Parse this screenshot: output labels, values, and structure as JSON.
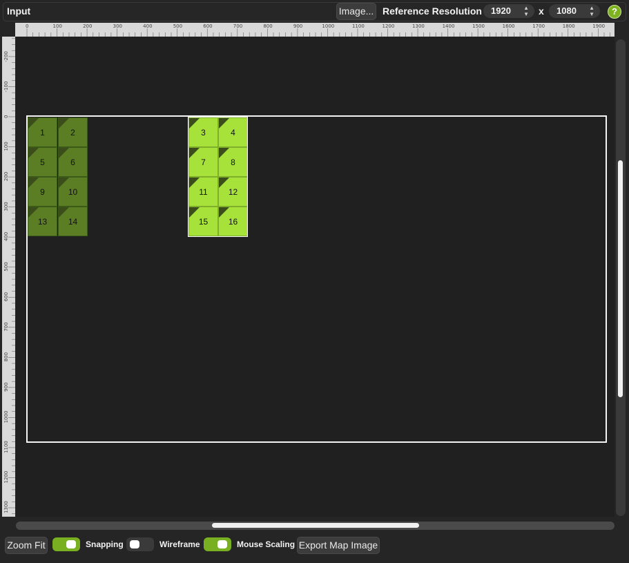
{
  "header": {
    "title": "Input",
    "image_button": "Image...",
    "ref_label": "Reference Resolution",
    "width": "1920",
    "x_label": "x",
    "height": "1080",
    "help": "?"
  },
  "ruler_h": [
    "0",
    "100",
    "200",
    "300",
    "400",
    "500",
    "600",
    "700",
    "800",
    "900",
    "1000",
    "1100",
    "1200",
    "1300",
    "1400",
    "1500",
    "1600",
    "1700",
    "1800",
    "1900"
  ],
  "ruler_v": [
    "-200",
    "-100",
    "0",
    "100",
    "200",
    "300",
    "400",
    "500",
    "600",
    "700",
    "800",
    "900",
    "1000",
    "1100",
    "1200",
    "1300"
  ],
  "tiles": [
    {
      "label": "1",
      "style": "dark"
    },
    {
      "label": "2",
      "style": "dark"
    },
    {
      "label": "3",
      "style": "light"
    },
    {
      "label": "4",
      "style": "light"
    },
    {
      "label": "5",
      "style": "dark"
    },
    {
      "label": "6",
      "style": "dark"
    },
    {
      "label": "7",
      "style": "light"
    },
    {
      "label": "8",
      "style": "light"
    },
    {
      "label": "9",
      "style": "dark"
    },
    {
      "label": "10",
      "style": "dark"
    },
    {
      "label": "11",
      "style": "light"
    },
    {
      "label": "12",
      "style": "light"
    },
    {
      "label": "13",
      "style": "dark"
    },
    {
      "label": "14",
      "style": "dark"
    },
    {
      "label": "15",
      "style": "light"
    },
    {
      "label": "16",
      "style": "light"
    }
  ],
  "footer": {
    "zoom_fit": "Zoom Fit",
    "snapping": {
      "label": "Snapping",
      "on": true
    },
    "wireframe": {
      "label": "Wireframe",
      "on": false
    },
    "mouse_scaling": {
      "label": "Mouse Scaling",
      "on": true
    },
    "export": "Export Map Image"
  },
  "colors": {
    "accent": "#79b021",
    "tile_dark": "#5b7d23",
    "tile_light": "#a7e23a"
  }
}
